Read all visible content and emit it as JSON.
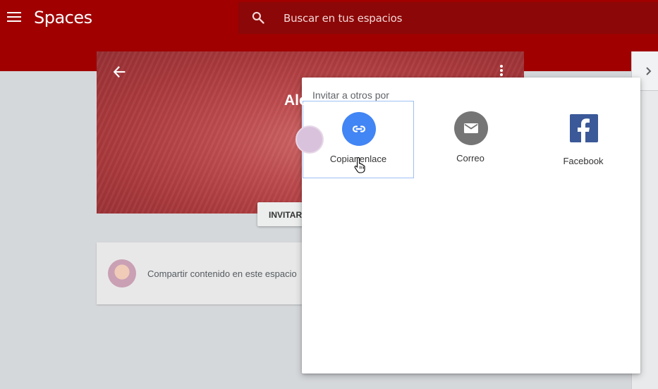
{
  "app": {
    "title": "Spaces"
  },
  "search": {
    "placeholder": "Buscar en tus espacios"
  },
  "space": {
    "title_visible": "Alc",
    "invite_label": "INVITAR"
  },
  "compose": {
    "prompt": "Compartir contenido en este espacio"
  },
  "share_popup": {
    "heading": "Invitar a otros por",
    "options": [
      {
        "label": "Copiar enlace",
        "icon": "link-icon",
        "color": "#4285f4"
      },
      {
        "label": "Correo",
        "icon": "mail-icon",
        "color": "#757575"
      },
      {
        "label": "Facebook",
        "icon": "facebook-icon",
        "color": "#3b5998"
      }
    ]
  },
  "colors": {
    "appbar": "#a00000",
    "searchbar": "#8c0707",
    "selection_border": "#9ec0f3"
  }
}
